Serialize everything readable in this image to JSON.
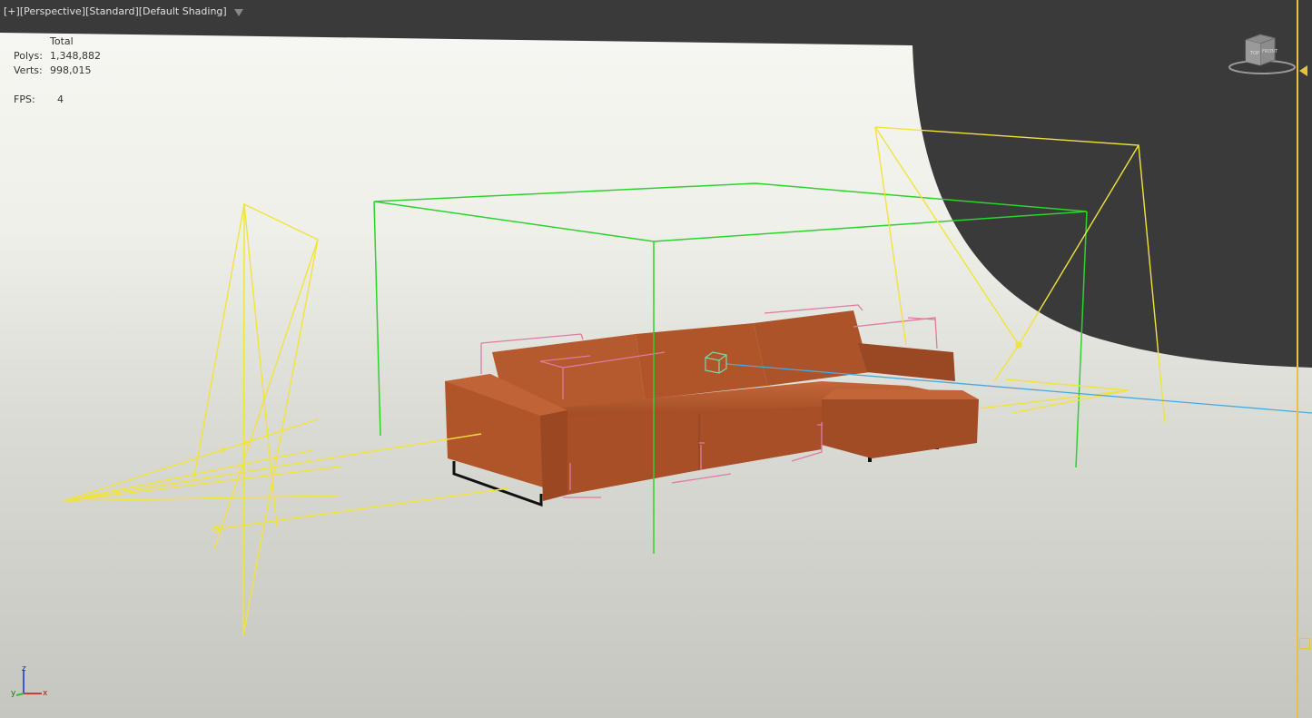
{
  "viewport": {
    "labels": [
      "[+]",
      "[Perspective]",
      "[Standard]",
      "[Default Shading]"
    ]
  },
  "stats": {
    "header": "Total",
    "polys_label": "Polys:",
    "polys_value": "1,348,882",
    "verts_label": "Verts:",
    "verts_value": "998,015",
    "fps_label": "FPS:",
    "fps_value": "4"
  },
  "viewcube": {
    "faces": [
      "TOP",
      "FRONT"
    ]
  },
  "axis": {
    "x": "x",
    "y": "y",
    "z": "z"
  },
  "colors": {
    "light_gizmo": "#f2e33a",
    "bbox_green": "#2bd42b",
    "selection_pink": "#e07aa0",
    "target_line": "#4aa8e0",
    "sofa": "#b0542a",
    "background_dark": "#3a3a3a",
    "studio_floor": "#c8c8c2"
  }
}
